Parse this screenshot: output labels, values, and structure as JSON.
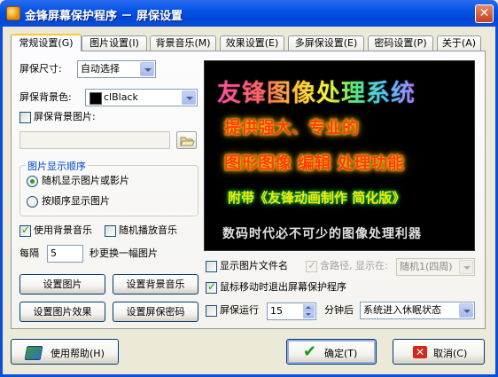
{
  "window": {
    "title": "金锋屏幕保护程序 － 屏保设置",
    "close_label": "✕"
  },
  "tabs": [
    {
      "label": "常规设置(G)"
    },
    {
      "label": "图片设置(I)"
    },
    {
      "label": "背景音乐(M)"
    },
    {
      "label": "效果设置(E)"
    },
    {
      "label": "多屏保设置(E)"
    },
    {
      "label": "密码设置(P)"
    },
    {
      "label": "关于(A)"
    }
  ],
  "general": {
    "size_label": "屏保尺寸:",
    "size_value": "自动选择",
    "bgcolor_label": "屏保背景色:",
    "bgcolor_value": "clBlack",
    "bgcolor_swatch": "#000000",
    "bgimage_label": "屏保背景图片:",
    "bgimage_checked": false,
    "bgimage_path": "",
    "order_group_title": "图片显示顺序",
    "order_random": "随机显示图片或影片",
    "order_sequential": "按顺序显示图片",
    "order_selected": "random",
    "use_music_label": "使用背景音乐",
    "use_music_checked": true,
    "random_music_label": "随机播放音乐",
    "random_music_checked": false,
    "interval_prefix": "每隔",
    "interval_value": "5",
    "interval_suffix": "秒更换一幅图片",
    "btn_set_image": "设置图片",
    "btn_set_bg": "设置背景音乐",
    "btn_image_effect": "设置图片效果",
    "btn_password": "设置屏保密码",
    "show_filename_label": "显示图片文件名",
    "show_filename_checked": false,
    "with_path_label": "含路径, 显示在:",
    "with_path_checked": true,
    "position_value": "随机1(四周)",
    "exit_on_mouse_label": "鼠标移动时退出屏幕保护程序",
    "exit_on_mouse_checked": true,
    "run_label": "屏保运行",
    "run_checked": false,
    "run_minutes": "15",
    "after_minutes_label": "分钟后",
    "after_action_value": "系统进入休眠状态"
  },
  "preview": {
    "line1": "友锋图像处理系统",
    "line2": "提供强大、专业的",
    "line3": "图形图像 编辑 处理功能",
    "line4": "附带《友锋动画制作 简化版》",
    "line5": "数码时代必不可少的图像处理利器"
  },
  "footer": {
    "help_label": "使用帮助(H)",
    "ok_label": "确定(T)",
    "cancel_label": "取消(C)"
  },
  "icons": [
    "app-icon",
    "close-icon",
    "folder-open-icon",
    "help-book-icon",
    "checkmark-icon",
    "cancel-x-icon"
  ]
}
